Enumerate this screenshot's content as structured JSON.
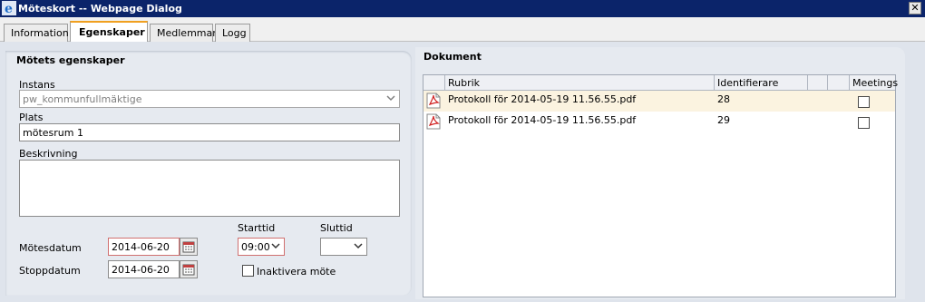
{
  "window": {
    "title": "Möteskort -- Webpage Dialog",
    "close_glyph": "✕"
  },
  "tabs": [
    {
      "label": "Information",
      "active": false
    },
    {
      "label": "Egenskaper",
      "active": true
    },
    {
      "label": "Medlemmar",
      "active": false
    },
    {
      "label": "Logg",
      "active": false
    }
  ],
  "properties": {
    "heading": "Mötets egenskaper",
    "instans_label": "Instans",
    "instans_value": "pw_kommunfullmäktige",
    "plats_label": "Plats",
    "plats_value": "mötesrum 1",
    "beskrivning_label": "Beskrivning",
    "beskrivning_value": "",
    "starttid_label": "Starttid",
    "sluttid_label": "Sluttid",
    "motesdatum_label": "Mötesdatum",
    "motesdatum_value": "2014-06-20",
    "starttid_value": "09:00",
    "sluttid_value": "",
    "stoppdatum_label": "Stoppdatum",
    "stoppdatum_value": "2014-06-20",
    "inaktivera_label": "Inaktivera möte",
    "inaktivera_checked": false
  },
  "documents": {
    "heading": "Dokument",
    "columns": [
      "Rubrik",
      "Identifierare",
      "",
      "",
      "Meetings"
    ],
    "rows": [
      {
        "rubrik": "Protokoll för 2014-05-19 11.56.55.pdf",
        "id": "28",
        "meetings": false,
        "selected": true
      },
      {
        "rubrik": "Protokoll för 2014-05-19 11.56.55.pdf",
        "id": "29",
        "meetings": false,
        "selected": false
      }
    ]
  },
  "colors": {
    "titlebar": "#0b246a",
    "active_tab_accent": "#f0a020",
    "panel_bg": "#e6eaf0",
    "selected_row": "#fbf3e0",
    "date_border": "#d07070"
  }
}
